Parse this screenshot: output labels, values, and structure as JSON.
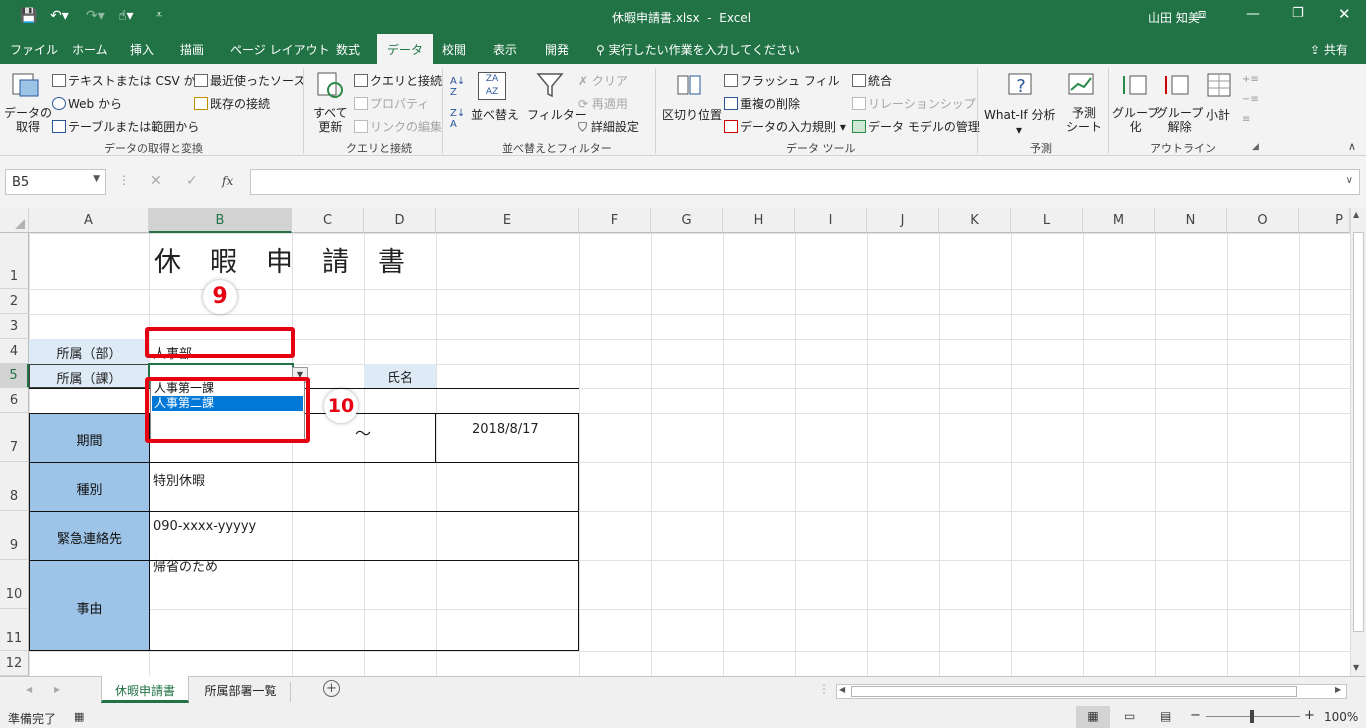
{
  "title": {
    "file": "休暇申請書.xlsx",
    "sep": "-",
    "app": "Excel",
    "user": "山田 知美"
  },
  "tabs": [
    "ファイル",
    "ホーム",
    "挿入",
    "描画",
    "ページ レイアウト",
    "数式",
    "データ",
    "校閲",
    "表示",
    "開発"
  ],
  "tell_me": "実行したい作業を入力してください",
  "share": "共有",
  "ribbon": {
    "get_data": "データの\n取得",
    "text_csv": "テキストまたは CSV から",
    "web": "Web から",
    "table_range": "テーブルまたは範囲から",
    "recent": "最近使ったソース",
    "existing": "既存の接続",
    "group_get": "データの取得と変換",
    "refresh_all": "すべて\n更新",
    "queries": "クエリと接続",
    "properties": "プロパティ",
    "edit_links": "リンクの編集",
    "group_queries": "クエリと接続",
    "sort": "並べ替え",
    "filter": "フィルター",
    "clear": "クリア",
    "reapply": "再適用",
    "advanced": "詳細設定",
    "group_sort": "並べ替えとフィルター",
    "text_to_cols": "区切り位置",
    "flash_fill": "フラッシュ フィル",
    "remove_dup": "重複の削除",
    "validation": "データの入力規則",
    "consolidate": "統合",
    "relationships": "リレーションシップ",
    "data_model": "データ モデルの管理",
    "group_tools": "データ ツール",
    "what_if": "What-If 分析",
    "forecast": "予測\nシート",
    "group_forecast": "予測",
    "group_btn": "グループ\n化",
    "ungroup": "グループ\n解除",
    "subtotal": "小計",
    "group_outline": "アウトライン"
  },
  "namebox": "B5",
  "fx_label": "fx",
  "columns": [
    "A",
    "B",
    "C",
    "D",
    "E",
    "F",
    "G",
    "H",
    "I",
    "J",
    "K",
    "L",
    "M",
    "N",
    "O",
    "P"
  ],
  "rows": [
    "1",
    "2",
    "3",
    "4",
    "5",
    "6",
    "7",
    "8",
    "9",
    "10",
    "11",
    "12"
  ],
  "sheet": {
    "title": "休　暇　申　請　書",
    "dept_label": "所属（部）",
    "dept_value": "人事部",
    "section_label": "所属（課）",
    "name_label": "氏名",
    "period_label": "期間",
    "tilde": "～",
    "end_date": "2018/8/17",
    "type_label": "種別",
    "type_value": "特別休暇",
    "contact_label": "緊急連絡先",
    "contact_value": "090-xxxx-yyyyy",
    "reason_label": "事由",
    "reason_value": "帰省のため"
  },
  "dropdown": {
    "options": [
      "人事第一課",
      "人事第二課"
    ],
    "selected_index": 1
  },
  "annotations": {
    "step9": "9",
    "step10": "10"
  },
  "sheet_tabs": [
    "休暇申請書",
    "所属部署一覧"
  ],
  "status": {
    "ready": "準備完了",
    "zoom": "100%"
  },
  "colors": {
    "excel_green": "#217346",
    "label_fill": "#9dc3e6",
    "highlight": "#e60012",
    "select_blue": "#0078d7"
  }
}
